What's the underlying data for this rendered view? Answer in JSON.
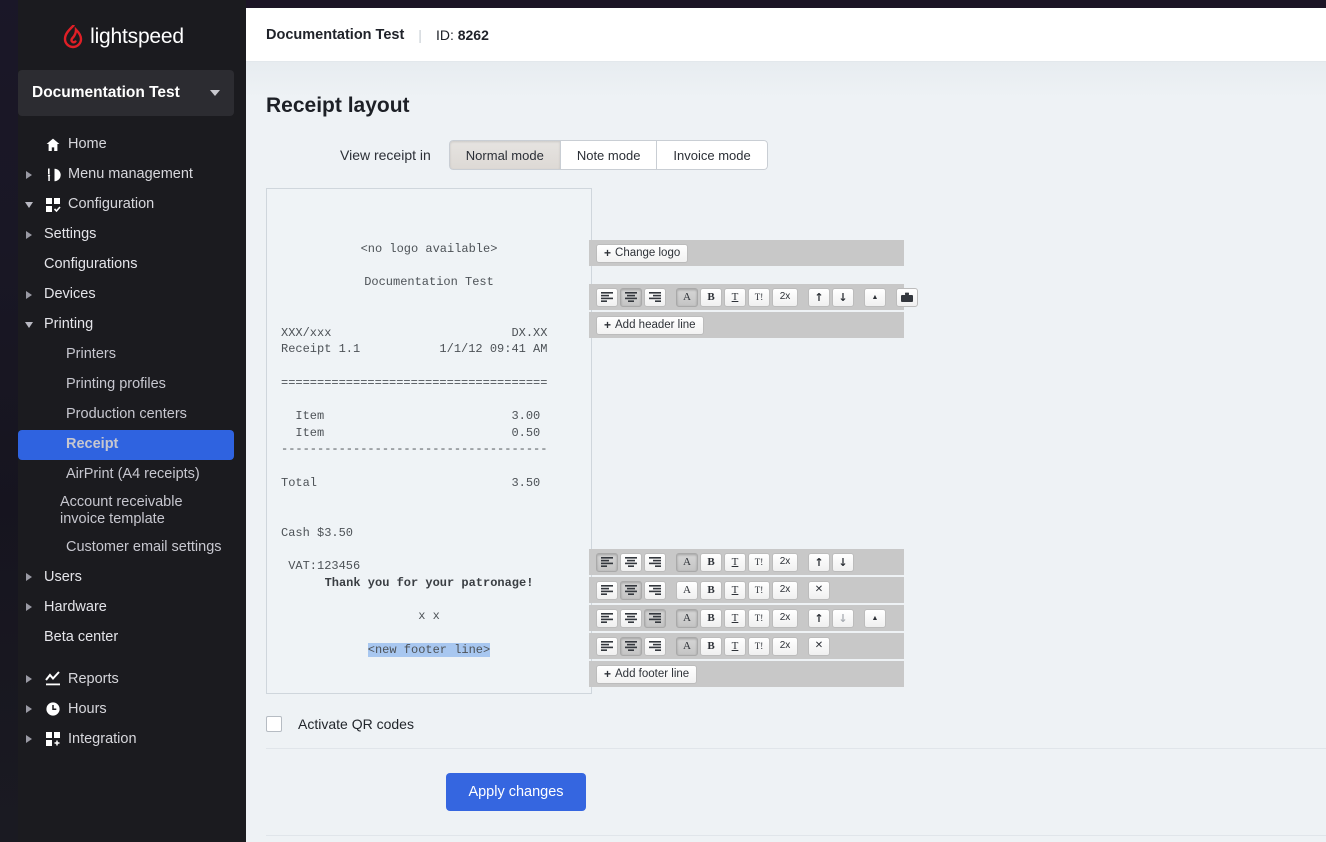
{
  "brand": {
    "name": "lightspeed",
    "logo_color": "#e01f26"
  },
  "account": {
    "name": "Documentation Test"
  },
  "sidebar": {
    "items": [
      {
        "label": "Home",
        "icon": "home-icon",
        "level": 1,
        "arrow": "none",
        "selected": false
      },
      {
        "label": "Menu management",
        "icon": "menu-management-icon",
        "level": 1,
        "arrow": "right",
        "selected": false
      },
      {
        "label": "Configuration",
        "icon": "configuration-icon",
        "level": 1,
        "arrow": "down",
        "selected": false
      },
      {
        "label": "Settings",
        "icon": "none",
        "level": 2,
        "arrow": "right",
        "selected": false
      },
      {
        "label": "Configurations",
        "icon": "none",
        "level": 2,
        "arrow": "none",
        "selected": false
      },
      {
        "label": "Devices",
        "icon": "none",
        "level": 2,
        "arrow": "right",
        "selected": false
      },
      {
        "label": "Printing",
        "icon": "none",
        "level": 2,
        "arrow": "down",
        "selected": false
      },
      {
        "label": "Printers",
        "icon": "none",
        "level": 3,
        "arrow": "none",
        "selected": false
      },
      {
        "label": "Printing profiles",
        "icon": "none",
        "level": 3,
        "arrow": "none",
        "selected": false
      },
      {
        "label": "Production centers",
        "icon": "none",
        "level": 3,
        "arrow": "none",
        "selected": false
      },
      {
        "label": "Receipt",
        "icon": "none",
        "level": 3,
        "arrow": "none",
        "selected": true
      },
      {
        "label": "AirPrint (A4 receipts)",
        "icon": "none",
        "level": 3,
        "arrow": "none",
        "selected": false
      },
      {
        "label": "Account receivable invoice template",
        "icon": "none",
        "level": 3,
        "arrow": "none",
        "selected": false,
        "noindent": true
      },
      {
        "label": "Customer email settings",
        "icon": "none",
        "level": 3,
        "arrow": "none",
        "selected": false
      },
      {
        "label": "Users",
        "icon": "none",
        "level": 2,
        "arrow": "right",
        "selected": false
      },
      {
        "label": "Hardware",
        "icon": "none",
        "level": 2,
        "arrow": "right",
        "selected": false
      },
      {
        "label": "Beta center",
        "icon": "none",
        "level": 2,
        "arrow": "none",
        "selected": false
      },
      {
        "label": "Reports",
        "icon": "reports-icon",
        "level": 1,
        "arrow": "right",
        "selected": false,
        "spaced": true
      },
      {
        "label": "Hours",
        "icon": "hours-icon",
        "level": 1,
        "arrow": "right",
        "selected": false
      },
      {
        "label": "Integration",
        "icon": "integration-icon",
        "level": 1,
        "arrow": "right",
        "selected": false
      }
    ]
  },
  "header": {
    "shop_name": "Documentation Test",
    "separator": "|",
    "id_label": "ID:",
    "id_value": "8262"
  },
  "main": {
    "page_title": "Receipt layout",
    "view_label": "View receipt in",
    "modes": [
      {
        "label": "Normal mode",
        "active": true
      },
      {
        "label": "Note mode",
        "active": false
      },
      {
        "label": "Invoice mode",
        "active": false
      }
    ],
    "qr_checkbox_label": "Activate QR codes",
    "qr_checked": false,
    "apply_label": "Apply changes",
    "apply_color": "#3566e0"
  },
  "receipt": {
    "lines": [
      {
        "text": "<no logo available>",
        "align": "center",
        "style": "normal"
      },
      {
        "text": "",
        "align": "left",
        "style": "blank"
      },
      {
        "text": "Documentation Test",
        "align": "center",
        "style": "normal"
      },
      {
        "text": "",
        "align": "left",
        "style": "blank"
      },
      {
        "text": "",
        "align": "left",
        "style": "blank"
      },
      {
        "text": "XXX/xxx                         DX.XX",
        "align": "left",
        "style": "pad"
      },
      {
        "text": "Receipt 1.1           1/1/12 09:41 AM",
        "align": "left",
        "style": "pad"
      },
      {
        "text": "",
        "align": "left",
        "style": "blank"
      },
      {
        "text": "=====================================",
        "align": "left",
        "style": "pad"
      },
      {
        "text": "",
        "align": "left",
        "style": "blank"
      },
      {
        "text": "  Item                          3.00",
        "align": "left",
        "style": "pad"
      },
      {
        "text": "  Item                          0.50",
        "align": "left",
        "style": "pad"
      },
      {
        "text": "-------------------------------------",
        "align": "left",
        "style": "pad"
      },
      {
        "text": "",
        "align": "left",
        "style": "blank"
      },
      {
        "text": "Total                           3.50",
        "align": "left",
        "style": "pad"
      },
      {
        "text": "",
        "align": "left",
        "style": "blank"
      },
      {
        "text": "",
        "align": "left",
        "style": "blank"
      },
      {
        "text": "Cash $3.50",
        "align": "left",
        "style": "pad"
      },
      {
        "text": "",
        "align": "left",
        "style": "blank"
      },
      {
        "text": " VAT:123456",
        "align": "left",
        "style": "pad"
      },
      {
        "text": "Thank you for your patronage!",
        "align": "center",
        "style": "bold"
      },
      {
        "text": "",
        "align": "left",
        "style": "blank"
      },
      {
        "text": "x x",
        "align": "center",
        "style": "normal"
      },
      {
        "text": "",
        "align": "left",
        "style": "blank"
      },
      {
        "text": "<new footer line>",
        "align": "center",
        "style": "selected"
      }
    ]
  },
  "toolbars": {
    "change_logo_label": "Change logo",
    "add_header_label": "Add header line",
    "add_footer_label": "Add footer line",
    "icons": {
      "align_left": "align-left-icon",
      "align_center": "align-center-icon",
      "align_right": "align-right-icon",
      "font_a": "A",
      "bold": "B",
      "underline": "T",
      "italic": "T!",
      "double": "2x",
      "move_up": "↑",
      "move_down": "↓",
      "collapse": "▲",
      "briefcase": "briefcase-icon",
      "remove": "✕"
    },
    "header_row": {
      "align_active": "center",
      "font_active": "A",
      "buttons": [
        "align-left",
        "align-center",
        "align-right",
        "A",
        "B",
        "T",
        "T!",
        "2x",
        "up",
        "down",
        "collapse",
        "briefcase"
      ]
    },
    "footer_rows": [
      {
        "align_active": "left",
        "font_active": "A",
        "buttons": [
          "align-left",
          "align-center",
          "align-right",
          "A",
          "B",
          "T",
          "T!",
          "2x",
          "up",
          "down"
        ]
      },
      {
        "align_active": "center",
        "font_active": "none",
        "buttons": [
          "align-left",
          "align-center",
          "align-right",
          "A",
          "B",
          "T",
          "T!",
          "2x",
          "remove"
        ]
      },
      {
        "align_active": "right",
        "font_active": "A",
        "buttons": [
          "align-left",
          "align-center",
          "align-right",
          "A",
          "B",
          "T",
          "T!",
          "2x",
          "up",
          "down-dim",
          "collapse"
        ]
      },
      {
        "align_active": "center",
        "font_active": "A",
        "buttons": [
          "align-left",
          "align-center",
          "align-right",
          "A",
          "B",
          "T",
          "T!",
          "2x",
          "remove"
        ]
      }
    ]
  }
}
